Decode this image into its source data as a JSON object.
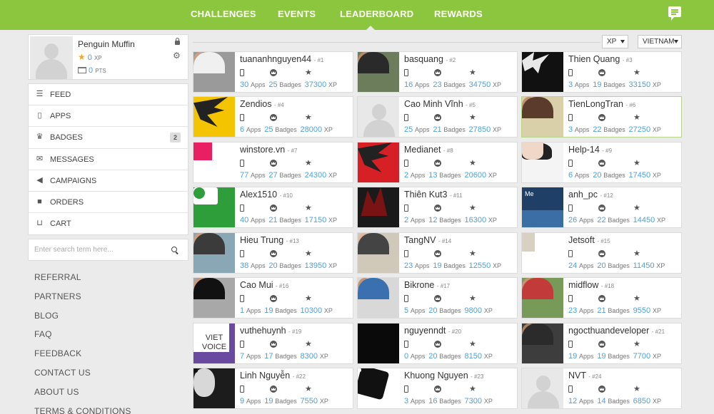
{
  "nav": {
    "items": [
      "CHALLENGES",
      "EVENTS",
      "LEADERBOARD",
      "REWARDS"
    ],
    "active": "LEADERBOARD"
  },
  "profile": {
    "name": "Penguin Muffin",
    "xp": "0",
    "xp_unit": "XP",
    "pts": "0",
    "pts_unit": "PTS"
  },
  "menu": {
    "items": [
      {
        "label": "FEED",
        "icon": "list-icon"
      },
      {
        "label": "APPS",
        "icon": "phone-icon"
      },
      {
        "label": "BADGES",
        "icon": "crown-icon",
        "count": "2"
      },
      {
        "label": "MESSAGES",
        "icon": "envelope-icon"
      },
      {
        "label": "CAMPAIGNS",
        "icon": "megaphone-icon"
      },
      {
        "label": "ORDERS",
        "icon": "truck-icon"
      },
      {
        "label": "CART",
        "icon": "cart-icon"
      }
    ]
  },
  "search": {
    "placeholder": "Enter search term here..."
  },
  "links": [
    "REFERRAL",
    "PARTNERS",
    "BLOG",
    "FAQ",
    "FEEDBACK",
    "CONTACT US",
    "ABOUT US",
    "TERMS & CONDITIONS"
  ],
  "filters": {
    "sort": "XP",
    "country": "VIETNAM"
  },
  "labels": {
    "apps": "Apps",
    "badges": "Badges",
    "xp": "XP"
  },
  "leaderboard": [
    {
      "name": "tuananhnguyen44",
      "rank": "- #1",
      "apps": "30",
      "badges": "25",
      "xp": "37300"
    },
    {
      "name": "basquang",
      "rank": "- #2",
      "apps": "16",
      "badges": "23",
      "xp": "34750"
    },
    {
      "name": "Thien Quang",
      "rank": "- #3",
      "apps": "3",
      "badges": "19",
      "xp": "33150"
    },
    {
      "name": "Zendios",
      "rank": "- #4",
      "apps": "6",
      "badges": "25",
      "xp": "28000"
    },
    {
      "name": "Cao Minh Vĩnh",
      "rank": "- #5",
      "apps": "25",
      "badges": "21",
      "xp": "27850"
    },
    {
      "name": "TienLongTran",
      "rank": "- #6",
      "apps": "3",
      "badges": "22",
      "xp": "27250"
    },
    {
      "name": "winstore.vn",
      "rank": "- #7",
      "apps": "77",
      "badges": "27",
      "xp": "24300"
    },
    {
      "name": "Medianet",
      "rank": "- #8",
      "apps": "2",
      "badges": "13",
      "xp": "20600"
    },
    {
      "name": "Help-14",
      "rank": "- #9",
      "apps": "6",
      "badges": "20",
      "xp": "17450"
    },
    {
      "name": "Alex1510",
      "rank": "- #10",
      "apps": "40",
      "badges": "21",
      "xp": "17150"
    },
    {
      "name": "Thiên Kut3",
      "rank": "- #11",
      "apps": "2",
      "badges": "12",
      "xp": "16300"
    },
    {
      "name": "anh_pc",
      "rank": "- #12",
      "apps": "26",
      "badges": "22",
      "xp": "14450"
    },
    {
      "name": "Hieu Trung",
      "rank": "- #13",
      "apps": "38",
      "badges": "20",
      "xp": "13950"
    },
    {
      "name": "TangNV",
      "rank": "- #14",
      "apps": "23",
      "badges": "19",
      "xp": "12550"
    },
    {
      "name": "Jetsoft",
      "rank": "- #15",
      "apps": "24",
      "badges": "20",
      "xp": "11450"
    },
    {
      "name": "Cao Mui",
      "rank": "- #16",
      "apps": "1",
      "badges": "19",
      "xp": "10300"
    },
    {
      "name": "Bikrone",
      "rank": "- #17",
      "apps": "5",
      "badges": "20",
      "xp": "9800"
    },
    {
      "name": "midflow",
      "rank": "- #18",
      "apps": "23",
      "badges": "21",
      "xp": "9550"
    },
    {
      "name": "vuthehuynh",
      "rank": "- #19",
      "apps": "7",
      "badges": "17",
      "xp": "8300"
    },
    {
      "name": "nguyenndt",
      "rank": "- #20",
      "apps": "0",
      "badges": "20",
      "xp": "8150"
    },
    {
      "name": "ngocthuandeveloper",
      "rank": "- #21",
      "apps": "19",
      "badges": "19",
      "xp": "7700"
    },
    {
      "name": "Linh Nguyễn",
      "rank": "- #22",
      "apps": "9",
      "badges": "19",
      "xp": "7550"
    },
    {
      "name": "Khuong Nguyen",
      "rank": "- #23",
      "apps": "3",
      "badges": "16",
      "xp": "7300"
    },
    {
      "name": "NVT",
      "rank": "- #24",
      "apps": "12",
      "badges": "14",
      "xp": "6850"
    }
  ],
  "thumbnail_logo_text": {
    "anh_pc": "Me",
    "vuthehuynh": "VIET VOICE"
  },
  "colors": {
    "brand": "#8cc63f",
    "link": "#4aa3df",
    "star": "#f5a623",
    "highlight_border": "#b8d48c"
  }
}
